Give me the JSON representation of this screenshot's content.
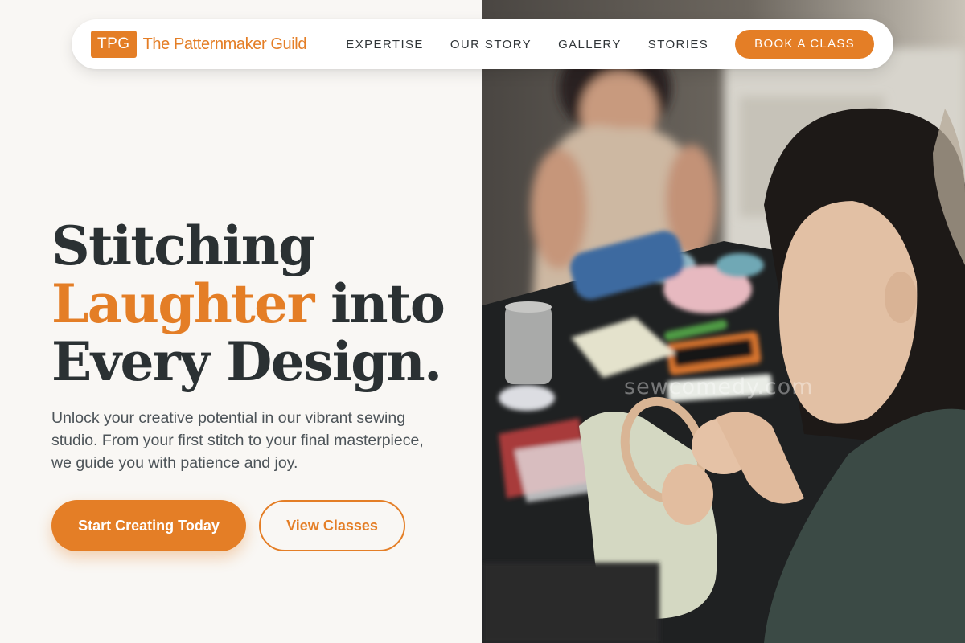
{
  "brand": {
    "badge": "TPG",
    "name": "The Patternmaker Guild",
    "accent_color": "#e47e26",
    "text_color": "#2b3133"
  },
  "nav": {
    "links": [
      "EXPERTISE",
      "OUR STORY",
      "GALLERY",
      "STORIES"
    ],
    "cta": "BOOK A CLASS"
  },
  "hero": {
    "headline_line1": "Stitching",
    "headline_accent": "Laughter",
    "headline_line2_rest": " into",
    "headline_line3": "Every Design.",
    "lead": "Unlock your creative potential in our vibrant sewing studio. From your first stitch to your final masterpiece, we guide you with patience and joy.",
    "primary_button": "Start Creating Today",
    "secondary_button": "View Classes"
  },
  "photo": {
    "watermark": "sewcomedy.com",
    "subject": "women-embroidering-at-workshop-table"
  }
}
